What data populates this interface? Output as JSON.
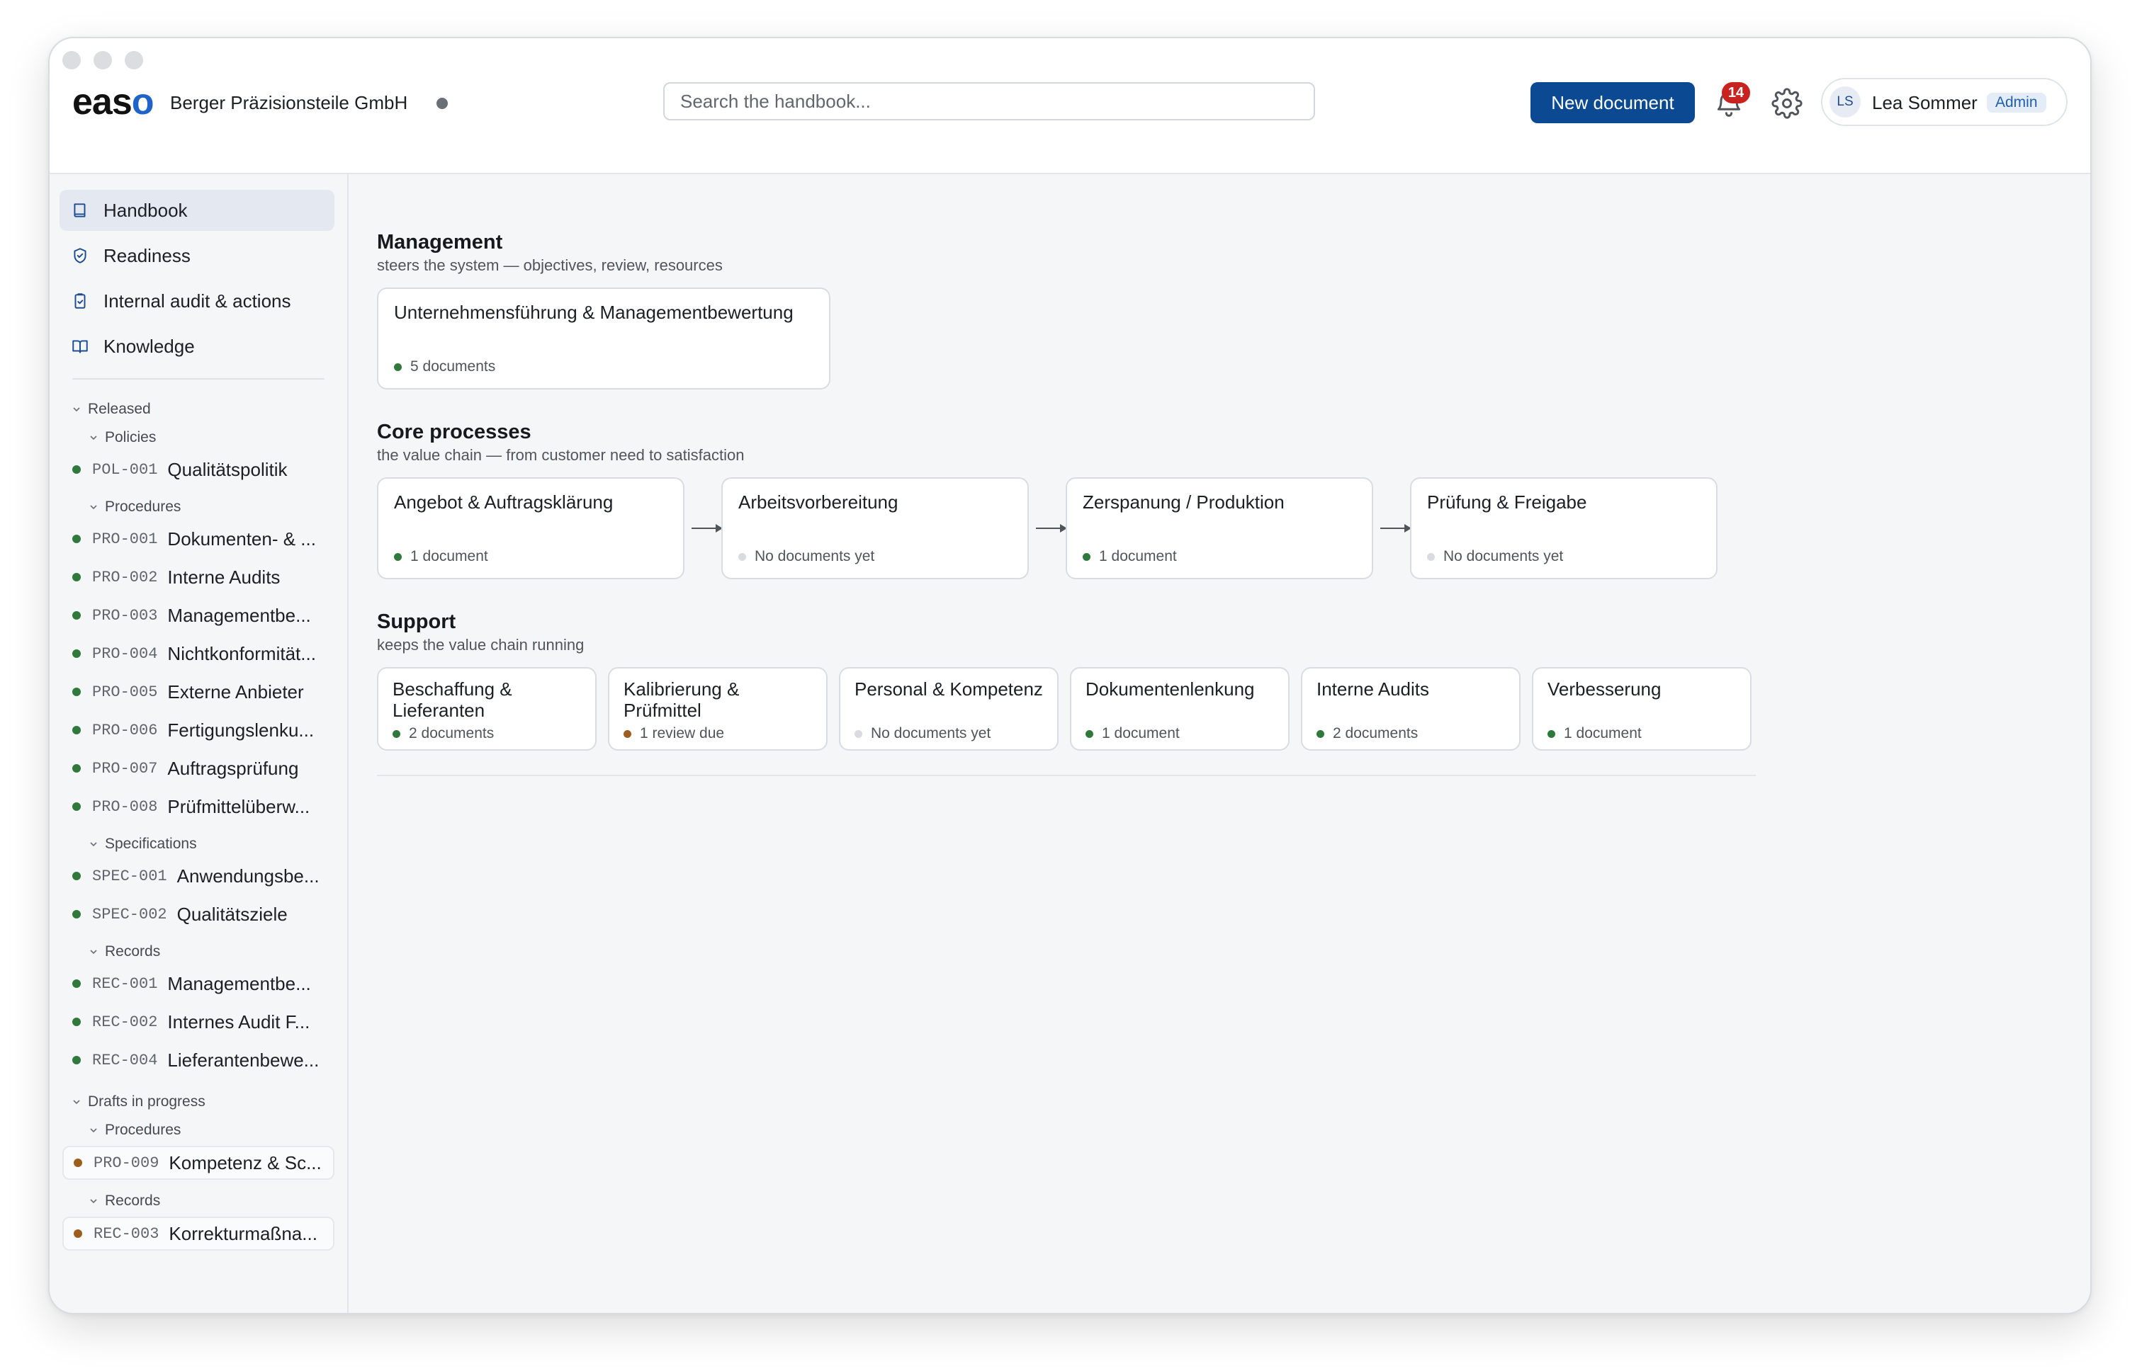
{
  "app": {
    "logo": "easo",
    "company": "Berger Präzisionsteile GmbH"
  },
  "header": {
    "search_placeholder": "Search the handbook...",
    "new_document_label": "New document",
    "notification_count": "14",
    "user_initials": "LS",
    "user_name": "Lea Sommer",
    "user_role": "Admin"
  },
  "sidebar": {
    "nav": [
      {
        "label": "Handbook",
        "icon": "book-icon",
        "active": true
      },
      {
        "label": "Readiness",
        "icon": "shield-check-icon"
      },
      {
        "label": "Internal audit & actions",
        "icon": "clipboard-check-icon"
      },
      {
        "label": "Knowledge",
        "icon": "open-book-icon"
      }
    ],
    "released_label": "Released",
    "policies_label": "Policies",
    "procedures_label": "Procedures",
    "specifications_label": "Specifications",
    "records_label": "Records",
    "drafts_label": "Drafts in progress",
    "drafts_procedures_label": "Procedures",
    "drafts_records_label": "Records",
    "policies": [
      {
        "code": "POL-001",
        "name": "Qualitätspolitik"
      }
    ],
    "procedures": [
      {
        "code": "PRO-001",
        "name": "Dokumenten- & ..."
      },
      {
        "code": "PRO-002",
        "name": "Interne Audits"
      },
      {
        "code": "PRO-003",
        "name": "Managementbe..."
      },
      {
        "code": "PRO-004",
        "name": "Nichtkonformität..."
      },
      {
        "code": "PRO-005",
        "name": "Externe Anbieter"
      },
      {
        "code": "PRO-006",
        "name": "Fertigungslenku..."
      },
      {
        "code": "PRO-007",
        "name": "Auftragsprüfung"
      },
      {
        "code": "PRO-008",
        "name": "Prüfmittelüberw..."
      }
    ],
    "specifications": [
      {
        "code": "SPEC-001",
        "name": "Anwendungsbe..."
      },
      {
        "code": "SPEC-002",
        "name": "Qualitätsziele"
      }
    ],
    "records": [
      {
        "code": "REC-001",
        "name": "Managementbe..."
      },
      {
        "code": "REC-002",
        "name": "Internes Audit F..."
      },
      {
        "code": "REC-004",
        "name": "Lieferantenbewe..."
      }
    ],
    "draft_procedures": [
      {
        "code": "PRO-009",
        "name": "Kompetenz & Sc..."
      }
    ],
    "draft_records": [
      {
        "code": "REC-003",
        "name": "Korrekturmaßna..."
      }
    ]
  },
  "main": {
    "management": {
      "title": "Management",
      "subtitle": "steers the system — objectives, review, resources",
      "cards": [
        {
          "title": "Unternehmensführung & Managementbewertung",
          "status": "5 documents",
          "state": "green"
        }
      ]
    },
    "core": {
      "title": "Core processes",
      "subtitle": "the value chain — from customer need to satisfaction",
      "cards": [
        {
          "title": "Angebot & Auftragsklärung",
          "status": "1 document",
          "state": "green"
        },
        {
          "title": "Arbeitsvorbereitung",
          "status": "No documents yet",
          "state": "grey"
        },
        {
          "title": "Zerspanung / Produktion",
          "status": "1 document",
          "state": "green"
        },
        {
          "title": "Prüfung & Freigabe",
          "status": "No documents yet",
          "state": "grey"
        }
      ]
    },
    "support": {
      "title": "Support",
      "subtitle": "keeps the value chain running",
      "cards": [
        {
          "title": "Beschaffung & Lieferanten",
          "status": "2 documents",
          "state": "green"
        },
        {
          "title": "Kalibrierung & Prüfmittel",
          "status": "1 review due",
          "state": "amber"
        },
        {
          "title": "Personal & Kompetenz",
          "status": "No documents yet",
          "state": "grey"
        },
        {
          "title": "Dokumentenlenkung",
          "status": "1 document",
          "state": "green"
        },
        {
          "title": "Interne Audits",
          "status": "2 documents",
          "state": "green"
        },
        {
          "title": "Verbesserung",
          "status": "1 document",
          "state": "green"
        }
      ]
    }
  },
  "colors": {
    "primary": "#0b4a92",
    "status_green": "#2f7a3b",
    "status_amber": "#9d5d1c",
    "status_grey": "#d9dbe0",
    "badge_red": "#c8231f"
  }
}
